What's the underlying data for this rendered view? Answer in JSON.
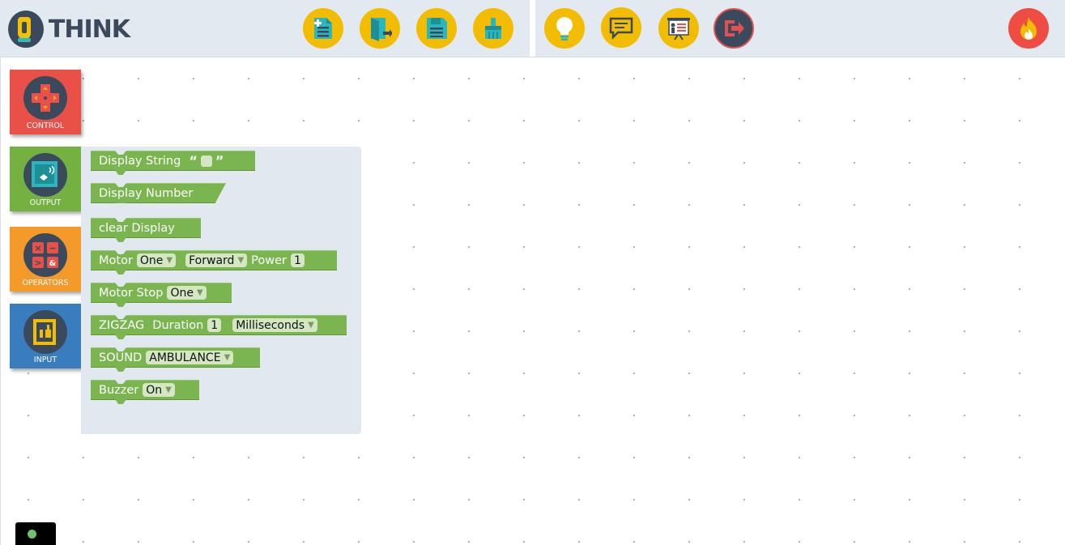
{
  "app": {
    "logo_text": "THINK"
  },
  "toolbar_left": [
    {
      "name": "new-file-button",
      "icon": "new-file-icon"
    },
    {
      "name": "open-file-button",
      "icon": "open-file-icon"
    },
    {
      "name": "save-button",
      "icon": "save-icon"
    },
    {
      "name": "clean-button",
      "icon": "broom-icon"
    }
  ],
  "toolbar_right": [
    {
      "name": "hint-button",
      "icon": "lightbulb-icon"
    },
    {
      "name": "chat-button",
      "icon": "chat-icon"
    },
    {
      "name": "presentation-button",
      "icon": "presentation-icon"
    },
    {
      "name": "logout-button",
      "icon": "logout-icon"
    },
    {
      "name": "profile-button",
      "icon": "flame-icon"
    }
  ],
  "categories": [
    {
      "label": "CONTROL",
      "color": "#e85048",
      "icon": "dpad-icon"
    },
    {
      "label": "OUTPUT",
      "color": "#74b140",
      "icon": "display-icon"
    },
    {
      "label": "OPERATORS",
      "color": "#f39a2b",
      "icon": "operators-icon"
    },
    {
      "label": "INPUT",
      "color": "#3a7dbf",
      "icon": "sensor-icon"
    }
  ],
  "blocks": {
    "display_string": {
      "label": "Display String",
      "open_quote": "“",
      "close_quote": "”"
    },
    "display_number": {
      "label": "Display Number"
    },
    "clear_display": {
      "label": "clear Display"
    },
    "motor": {
      "label": "Motor",
      "motor_value": "One",
      "direction_value": "Forward",
      "power_label": "Power",
      "power_value": "1"
    },
    "motor_stop": {
      "label": "Motor Stop",
      "motor_value": "One"
    },
    "zigzag": {
      "label": "ZIGZAG",
      "duration_label": "Duration",
      "duration_value": "1",
      "unit_value": "Milliseconds"
    },
    "sound": {
      "label": "SOUND",
      "sound_value": "AMBULANCE"
    },
    "buzzer": {
      "label": "Buzzer",
      "state_value": "On"
    }
  },
  "colors": {
    "accent": "#f2bd00",
    "block_green": "#7ab550",
    "header_bg": "#e3e9f0"
  }
}
